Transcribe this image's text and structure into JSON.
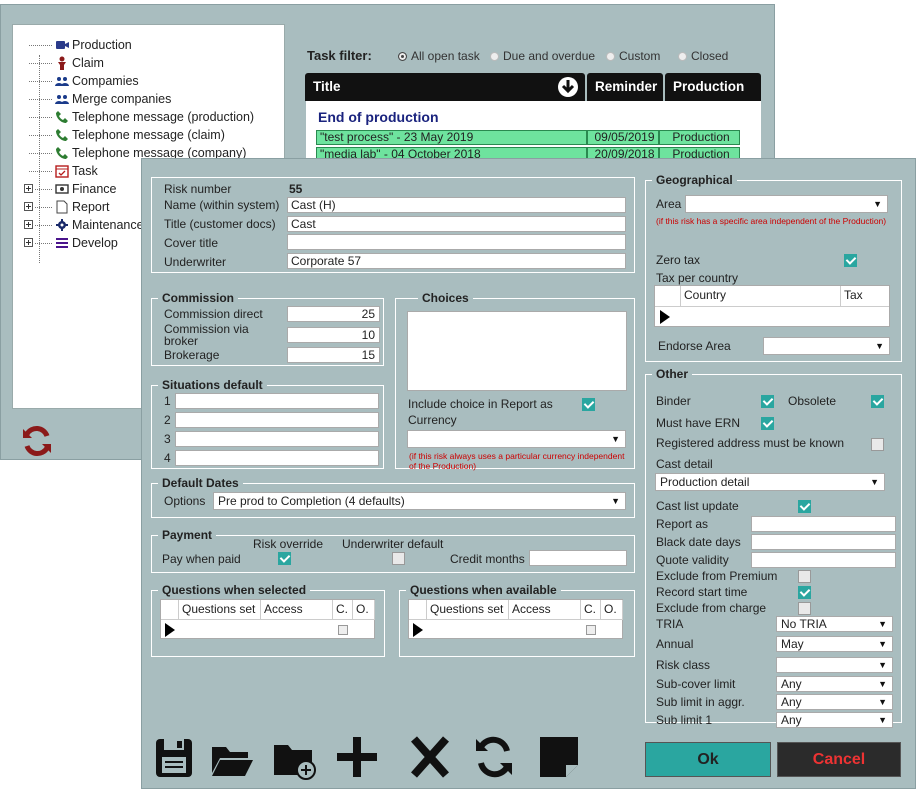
{
  "tree": {
    "items": [
      {
        "label": "Production",
        "icon": "video-camera-icon"
      },
      {
        "label": "Claim",
        "icon": "claim-person-icon"
      },
      {
        "label": "Compamies",
        "icon": "group-icon"
      },
      {
        "label": "Merge companies",
        "icon": "group-icon"
      },
      {
        "label": "Telephone message (production)",
        "icon": "phone-icon"
      },
      {
        "label": "Telephone message (claim)",
        "icon": "phone-icon"
      },
      {
        "label": "Telephone message (company)",
        "icon": "phone-icon"
      },
      {
        "label": "Task",
        "icon": "calendar-icon"
      },
      {
        "label": "Finance",
        "icon": "money-icon"
      },
      {
        "label": "Report",
        "icon": "document-icon"
      },
      {
        "label": "Maintenance",
        "icon": "gear-icon"
      },
      {
        "label": "Develop",
        "icon": "bars-icon"
      }
    ]
  },
  "task_filter": {
    "label": "Task filter:",
    "options": [
      "All open task",
      "Due and overdue",
      "Custom",
      "Closed"
    ],
    "selected": "All open task"
  },
  "task_table": {
    "headers": {
      "title": "Title",
      "reminder": "Reminder",
      "production": "Production"
    },
    "group": "End of production",
    "rows": [
      {
        "title": "\"test process\" - 23 May 2019",
        "reminder": "09/05/2019",
        "production": "Production"
      },
      {
        "title": "\"media lab\" - 04 October 2018",
        "reminder": "20/09/2018",
        "production": "Production"
      }
    ]
  },
  "risk": {
    "risk_number_label": "Risk number",
    "risk_number": "55",
    "name_label": "Name (within system)",
    "name": "Cast (H)",
    "title_label": "Title (customer docs)",
    "title": "Cast",
    "cover_title_label": "Cover title",
    "cover_title": "",
    "underwriter_label": "Underwriter",
    "underwriter": "Corporate 57"
  },
  "commission": {
    "legend": "Commission",
    "direct_label": "Commission direct",
    "direct": "25",
    "broker_label": "Commission via broker",
    "broker": "10",
    "brokerage_label": "Brokerage",
    "brokerage": "15"
  },
  "choices": {
    "legend": "Choices",
    "include_label": "Include choice in Report as",
    "include_checked": true,
    "currency_label": "Currency",
    "currency_value": "",
    "currency_note": "(if this risk always uses a particular currency independent of the Production)"
  },
  "situations": {
    "legend": "Situations default",
    "rows": [
      {
        "n": "1",
        "v": ""
      },
      {
        "n": "2",
        "v": ""
      },
      {
        "n": "3",
        "v": ""
      },
      {
        "n": "4",
        "v": ""
      }
    ]
  },
  "default_dates": {
    "legend": "Default Dates",
    "options_label": "Options",
    "options_value": "Pre prod to Completion (4 defaults)"
  },
  "payment": {
    "legend": "Payment",
    "pay_when_paid": "Pay when paid",
    "risk_override": "Risk override",
    "risk_override_checked": true,
    "underwriter_default": "Underwriter default",
    "underwriter_default_checked": false,
    "credit_months": "Credit months",
    "credit_months_value": ""
  },
  "questions_selected": {
    "legend": "Questions when selected",
    "cols": [
      "Questions set",
      "Access",
      "C.",
      "O."
    ]
  },
  "questions_available": {
    "legend": "Questions when available",
    "cols": [
      "Questions set",
      "Access",
      "C.",
      "O."
    ]
  },
  "geographical": {
    "legend": "Geographical",
    "area_label": "Area",
    "area_value": "",
    "area_note": "(if this risk has a specific area independent of the Production)",
    "zero_tax_label": "Zero tax",
    "zero_tax": true,
    "tax_per_country_label": "Tax per country",
    "cols": [
      "Country",
      "Tax"
    ],
    "endorse_area_label": "Endorse Area",
    "endorse_area_value": ""
  },
  "other": {
    "legend": "Other",
    "binder_label": "Binder",
    "binder": true,
    "obsolete_label": "Obsolete",
    "obsolete": true,
    "must_have_ern_label": "Must have ERN",
    "must_have_ern": true,
    "registered_label": "Registered address must be known",
    "registered": false,
    "cast_detail_label": "Cast detail",
    "cast_detail_value": "Production detail",
    "cast_list_update_label": "Cast list update",
    "cast_list_update": true,
    "report_as_label": "Report as",
    "report_as": "",
    "black_date_label": "Black date days",
    "black_date": "",
    "quote_validity_label": "Quote validity",
    "quote_validity": "",
    "exclude_premium_label": "Exclude from Premium",
    "exclude_premium": false,
    "record_start_label": "Record start time",
    "record_start": true,
    "exclude_charge_label": "Exclude from charge",
    "exclude_charge": false,
    "tria_label": "TRIA",
    "tria_value": "No TRIA",
    "annual_label": "Annual",
    "annual_value": "May",
    "risk_class_label": "Risk class",
    "risk_class_value": "",
    "subcover_label": "Sub-cover limit",
    "subcover_value": "Any",
    "sublimit_aggr_label": "Sub limit in aggr.",
    "sublimit_aggr_value": "Any",
    "sublimit1_label": "Sub limit 1",
    "sublimit1_value": "Any"
  },
  "buttons": {
    "ok": "Ok",
    "cancel": "Cancel"
  },
  "colors": {
    "panel": "#a9bdbf",
    "accent": "#2aa6a0",
    "row_green": "#6ee39e",
    "cancel_text": "#ee3333"
  }
}
